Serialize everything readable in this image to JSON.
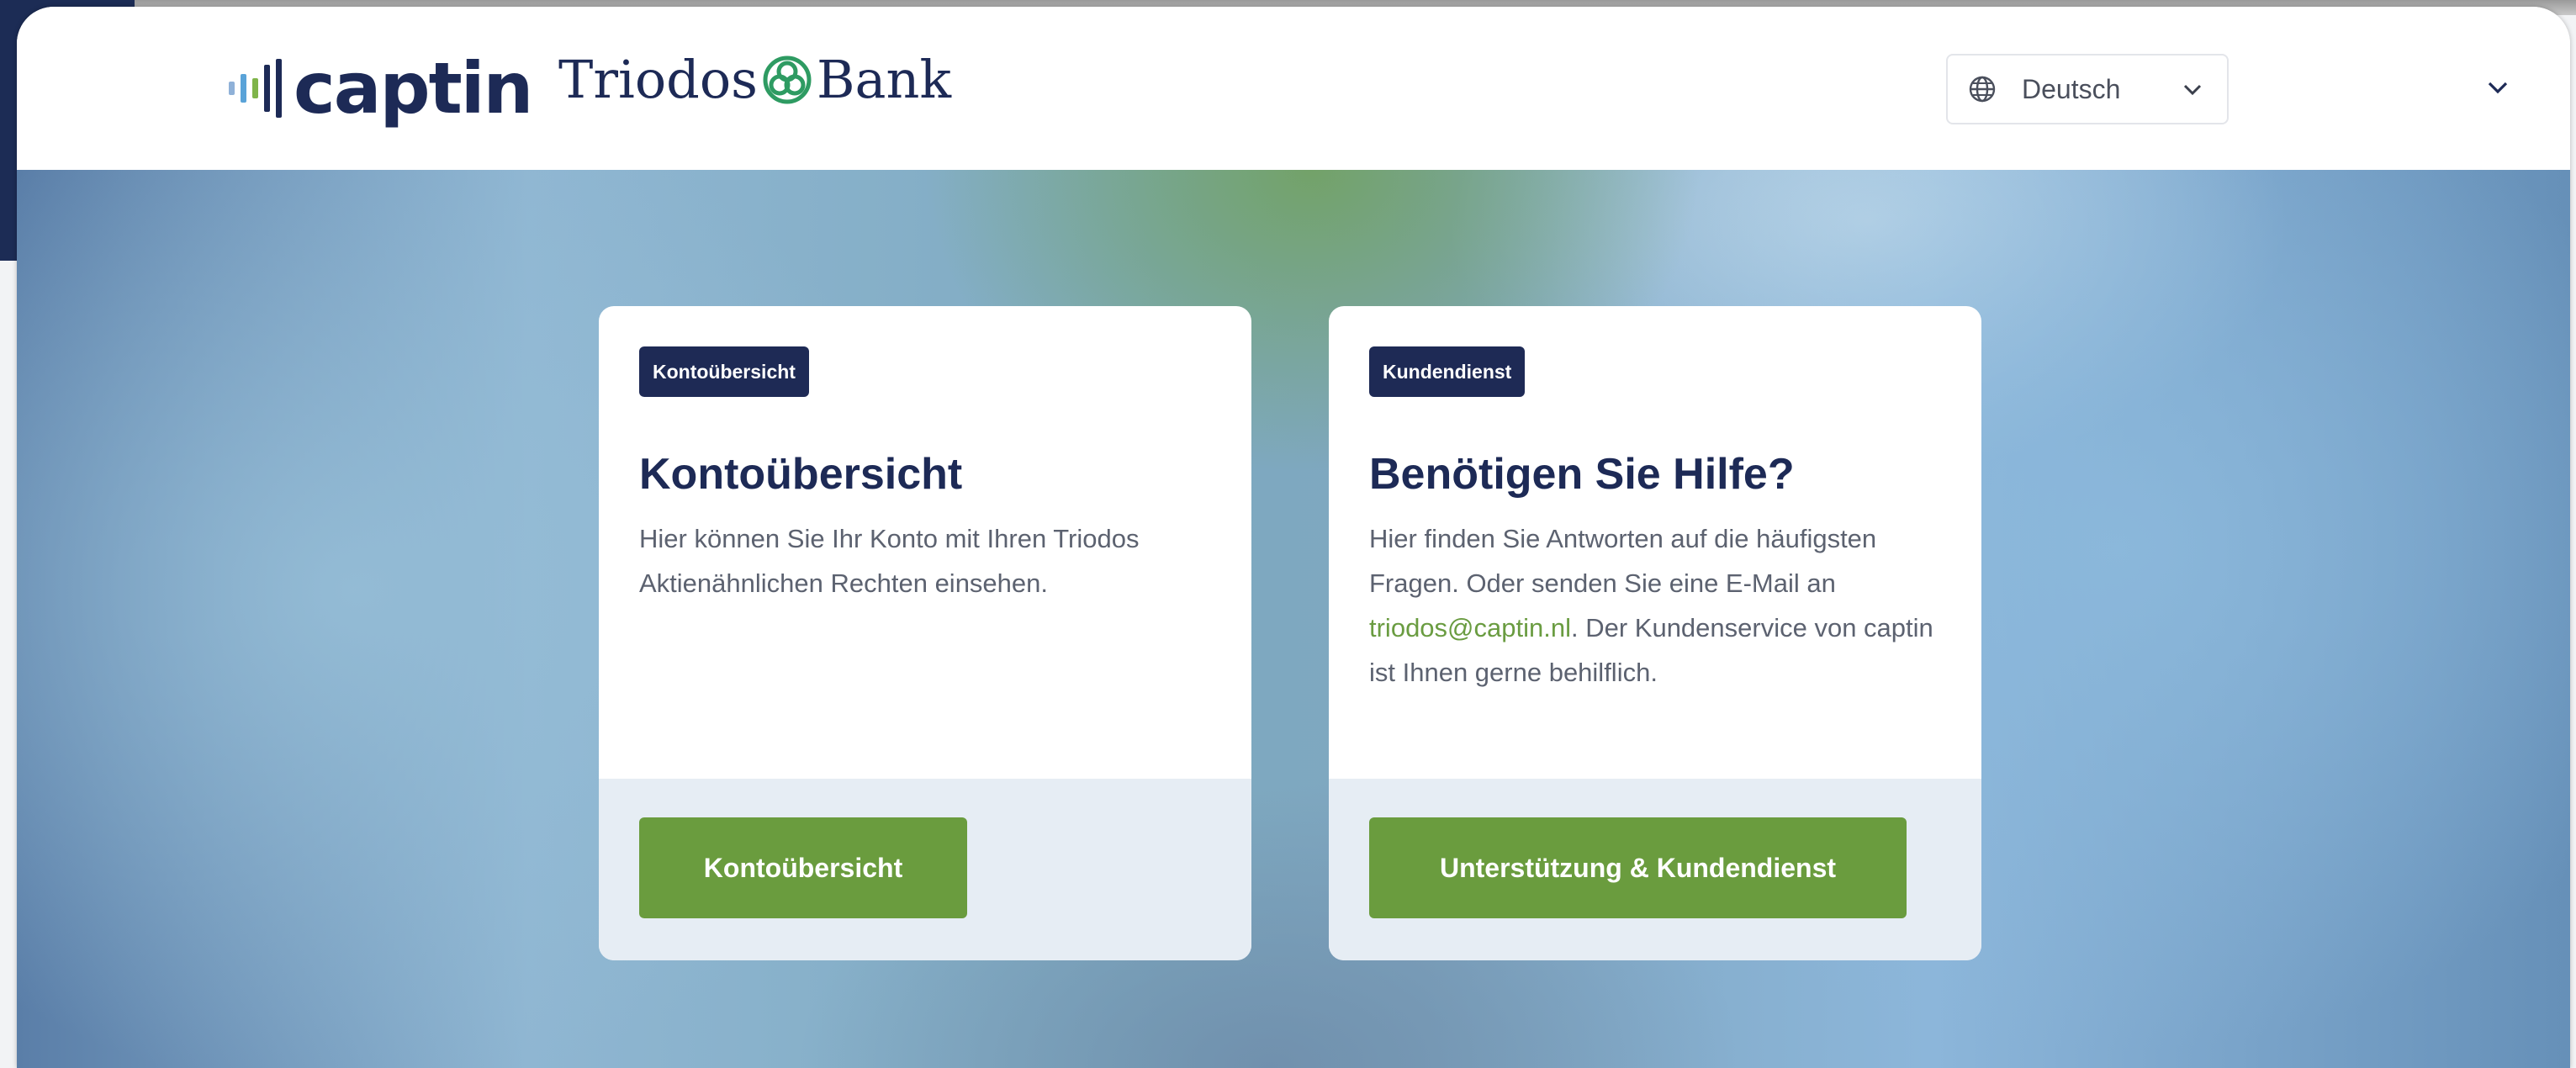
{
  "header": {
    "brand_name": "captin",
    "partner_name_1": "Triodos",
    "partner_name_2": "Bank",
    "language": {
      "selected": "Deutsch"
    }
  },
  "cards": [
    {
      "badge": "Kontoübersicht",
      "title": "Kontoübersicht",
      "text": "Hier können Sie Ihr Konto mit Ihren Triodos Aktienähnlichen Rechten einsehen.",
      "button_label": "Kontoübersicht"
    },
    {
      "badge": "Kundendienst",
      "title": "Benötigen Sie Hilfe?",
      "text_before": "Hier finden Sie Antworten auf die häufigsten Fragen. Oder senden Sie eine E-Mail an ",
      "email": "triodos@captin.nl",
      "text_after": ". Der Kundenservice von captin ist Ihnen gerne behilflich.",
      "button_label": "Unterstützung & Kundendienst"
    }
  ],
  "colors": {
    "navy": "#1d2a56",
    "green": "#6a9c3e",
    "link": "#6a9c41",
    "card_footer": "#e6edf4"
  },
  "icons": {
    "language": "globe-icon",
    "dropdown": "chevron-down-icon"
  }
}
